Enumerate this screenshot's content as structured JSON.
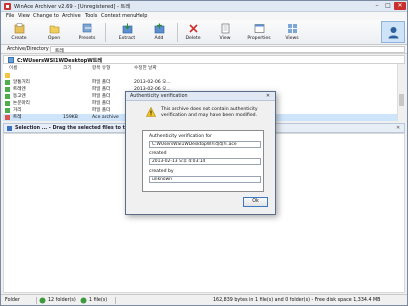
{
  "window": {
    "title": "WinAce Archiver v2.69 - [Unregistered] - 트레"
  },
  "menu": [
    "File",
    "View",
    "Change to",
    "Archive",
    "Tools",
    "Context menu",
    "Help"
  ],
  "toolbar": [
    "Create",
    "Open",
    "Presets",
    "Extract",
    "Add",
    "Delete",
    "View",
    "Properties",
    "Views"
  ],
  "address": {
    "label": "Archive/Directory",
    "value": "트레"
  },
  "path": "C:WUsersWSI1WDesktopW트레",
  "list": {
    "headers": [
      "이름",
      "크기",
      "항목 유형",
      "수정한 날짜"
    ],
    "rows": [
      {
        "name": "",
        "size": "",
        "type": "",
        "date": "",
        "color": "#f4c542"
      },
      {
        "name": "알통거리",
        "size": "",
        "type": "파일 폴더",
        "date": "2013-02-06 오...",
        "color": "#4cae4c"
      },
      {
        "name": "트레엔",
        "size": "",
        "type": "파일 폴더",
        "date": "2013-02-06 오...",
        "color": "#4cae4c"
      },
      {
        "name": "동고엔",
        "size": "",
        "type": "파일 폴더",
        "date": "2013-02-06 오...",
        "color": "#4cae4c"
      },
      {
        "name": "논문마리",
        "size": "",
        "type": "파일 폴더",
        "date": "2013-02-06 오...",
        "color": "#4cae4c"
      },
      {
        "name": "거리",
        "size": "",
        "type": "파일 폴더",
        "date": "2013-02-06 오...",
        "color": "#4cae4c"
      },
      {
        "name": "트레",
        "size": "159KB",
        "type": "Ace archive",
        "date": "2013-02-13 오...",
        "color": "#d9534f"
      }
    ]
  },
  "selection_bar": "Selection ... - Drag the selected files to the selecti",
  "dialog": {
    "title": "Authenticity verification",
    "message": "This archive does not contain authenticity verification and may have been modified.",
    "verification_for_label": "Authenticity verification for",
    "verification_for_value": "C:WUsersWSI1WDesktopW트레레트.ace",
    "created_label": "created",
    "created_value": "2013-02-13 오후 4:03:14",
    "created_by_label": "created by",
    "created_by_value": "unknown",
    "ok": "Ok"
  },
  "status": {
    "left": "Folder",
    "folders": "12 folder(s)",
    "files": "1 file(s)",
    "summary": "162,839 bytes in 1 file(s) and 0 folder(s) - Free disk space 1,334.4 MB"
  }
}
